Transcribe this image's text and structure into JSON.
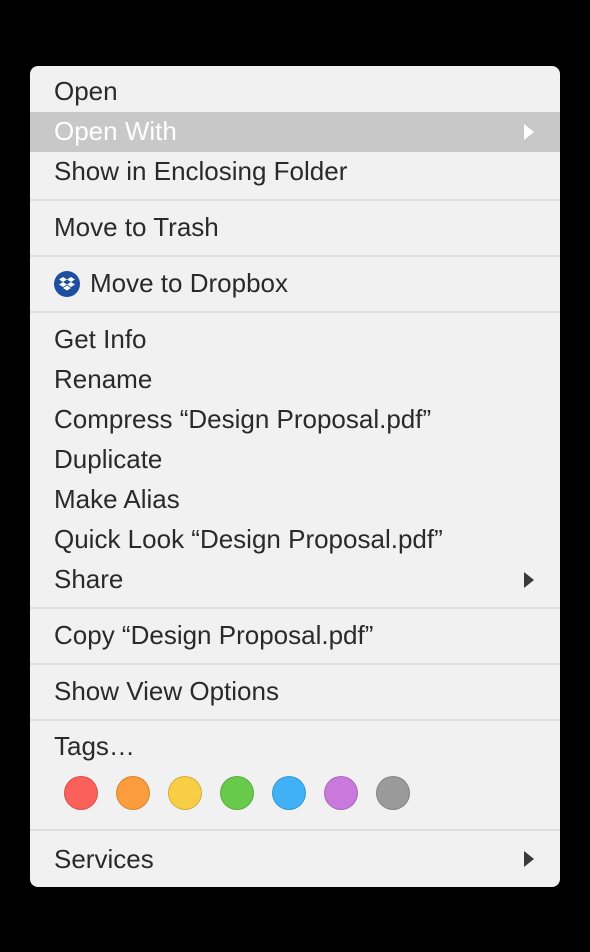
{
  "menu": {
    "open": "Open",
    "openWith": "Open With",
    "showInFolder": "Show in Enclosing Folder",
    "moveToTrash": "Move to Trash",
    "moveToDropbox": "Move to Dropbox",
    "getInfo": "Get Info",
    "rename": "Rename",
    "compress": "Compress “Design Proposal.pdf”",
    "duplicate": "Duplicate",
    "makeAlias": "Make Alias",
    "quickLook": "Quick Look “Design Proposal.pdf”",
    "share": "Share",
    "copy": "Copy “Design Proposal.pdf”",
    "showViewOptions": "Show View Options",
    "tags": "Tags…",
    "services": "Services"
  },
  "tagColors": {
    "red": "#fb605b",
    "orange": "#fb9c3d",
    "yellow": "#f7ce46",
    "green": "#68ca4a",
    "blue": "#41b1f6",
    "purple": "#c978dc",
    "gray": "#9a9a9a"
  }
}
